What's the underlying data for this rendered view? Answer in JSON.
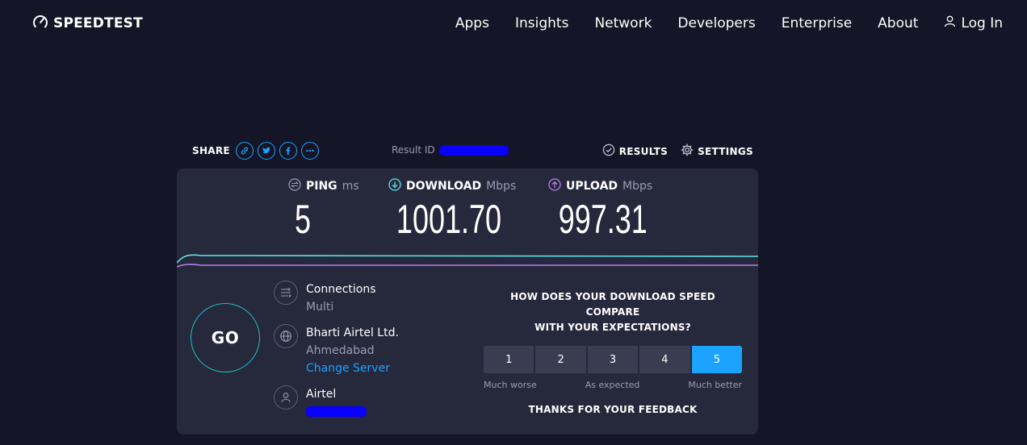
{
  "header": {
    "logo_text": "SPEEDTEST",
    "nav": [
      "Apps",
      "Insights",
      "Network",
      "Developers",
      "Enterprise",
      "About"
    ],
    "login": "Log In"
  },
  "share": {
    "label": "SHARE",
    "icons": [
      "link-icon",
      "twitter-icon",
      "facebook-icon",
      "more-icon"
    ]
  },
  "result": {
    "label": "Result ID"
  },
  "actions": {
    "results": "RESULTS",
    "settings": "SETTINGS"
  },
  "metrics": {
    "ping": {
      "name": "PING",
      "unit": "ms",
      "value": "5"
    },
    "download": {
      "name": "DOWNLOAD",
      "unit": "Mbps",
      "value": "1001.70"
    },
    "upload": {
      "name": "UPLOAD",
      "unit": "Mbps",
      "value": "997.31"
    }
  },
  "go_label": "GO",
  "connections": {
    "title": "Connections",
    "value": "Multi"
  },
  "server": {
    "name": "Bharti Airtel Ltd.",
    "location": "Ahmedabad",
    "change": "Change Server"
  },
  "isp": {
    "name": "Airtel"
  },
  "survey": {
    "question_line1": "HOW DOES YOUR DOWNLOAD SPEED COMPARE",
    "question_line2": "WITH YOUR EXPECTATIONS?",
    "options": [
      "1",
      "2",
      "3",
      "4",
      "5"
    ],
    "selected": "5",
    "label_low": "Much worse",
    "label_mid": "As expected",
    "label_high": "Much better",
    "thanks": "THANKS FOR YOUR FEEDBACK"
  },
  "colors": {
    "background": "#141526",
    "card": "#26283c",
    "accent_blue": "#1ba3ff",
    "download_line": "#5ee3e8",
    "upload_line": "#b97cf0",
    "redaction": "#0a00ff"
  }
}
